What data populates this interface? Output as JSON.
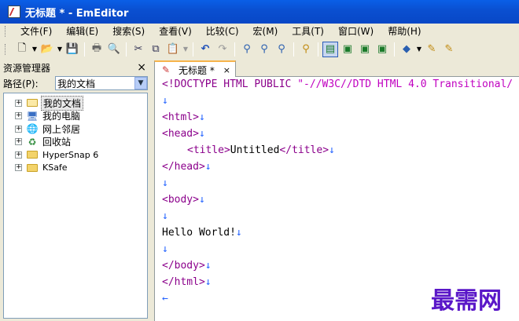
{
  "window": {
    "title": "无标题 * - EmEditor"
  },
  "menu": [
    "文件(F)",
    "编辑(E)",
    "搜索(S)",
    "查看(V)",
    "比较(C)",
    "宏(M)",
    "工具(T)",
    "窗口(W)",
    "帮助(H)"
  ],
  "explorer": {
    "title": "资源管理器",
    "close": "×",
    "path_label": "路径(P):",
    "path_value": "我的文档",
    "items": [
      {
        "label": "我的文档",
        "icon": "my-documents-icon"
      },
      {
        "label": "我的电脑",
        "icon": "my-computer-icon"
      },
      {
        "label": "网上邻居",
        "icon": "network-icon"
      },
      {
        "label": "回收站",
        "icon": "recycle-bin-icon"
      },
      {
        "label": "HyperSnap 6",
        "icon": "folder-icon"
      },
      {
        "label": "KSafe",
        "icon": "folder-icon"
      }
    ]
  },
  "tab": {
    "label": "无标题 *",
    "close": "×"
  },
  "editor": {
    "lines": {
      "l1a": "<!DOCTYPE HTML PUBLIC ",
      "l1b": "\"-//W3C//DTD HTML 4.0 Transitional/",
      "l3": "<html>",
      "l4": "<head>",
      "l5a": "<title>",
      "l5b": "Untitled",
      "l5c": "</title>",
      "l6": "</head>",
      "l8": "<body>",
      "l10": "Hello World!",
      "l12": "</body>",
      "l13": "</html>"
    },
    "eol_mark": "↓",
    "eof_mark": "←"
  },
  "watermark": "最需网",
  "colors": {
    "title_bar": "#0a54d6",
    "tag": "#8b008b",
    "string": "#c000c0",
    "eol": "#2060ff",
    "watermark": "#5a17c8"
  }
}
